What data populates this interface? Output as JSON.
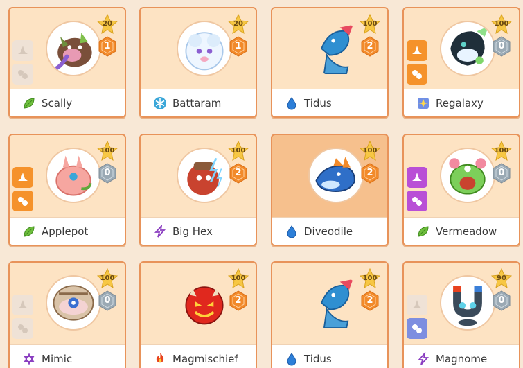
{
  "cards": [
    {
      "name": "Scally",
      "level": "20",
      "tier": "1",
      "element": "leaf"
    },
    {
      "name": "Battaram",
      "level": "20",
      "tier": "1",
      "element": "ice"
    },
    {
      "name": "Tidus",
      "level": "100",
      "tier": "2",
      "element": "water"
    },
    {
      "name": "Regalaxy",
      "level": "100",
      "tier": "0",
      "element": "astral"
    },
    {
      "name": "Applepot",
      "level": "100",
      "tier": "0",
      "element": "leaf"
    },
    {
      "name": "Big Hex",
      "level": "100",
      "tier": "2",
      "element": "storm"
    },
    {
      "name": "Diveodile",
      "level": "100",
      "tier": "2",
      "element": "water"
    },
    {
      "name": "Vermeadow",
      "level": "100",
      "tier": "0",
      "element": "leaf"
    },
    {
      "name": "Mimic",
      "level": "100",
      "tier": "0",
      "element": "shadow"
    },
    {
      "name": "Magmischief",
      "level": "100",
      "tier": "2",
      "element": "fire"
    },
    {
      "name": "Tidus",
      "level": "100",
      "tier": "2",
      "element": "water"
    },
    {
      "name": "Magnome",
      "level": "90",
      "tier": "0",
      "element": "storm"
    }
  ],
  "colors": {
    "background": "#f8e8d6",
    "card": "#fde3c3",
    "card_selected": "#f6c08d",
    "border": "#e8935a",
    "star": "#f7c744",
    "tier_orange": "#f28a2a",
    "tier_grey": "#9aa9b4",
    "spell_orange": "#f5922b",
    "spell_purple": "#b94fd6",
    "spell_faded": "#efe2d6",
    "spell_blue": "#7d8ee0"
  }
}
